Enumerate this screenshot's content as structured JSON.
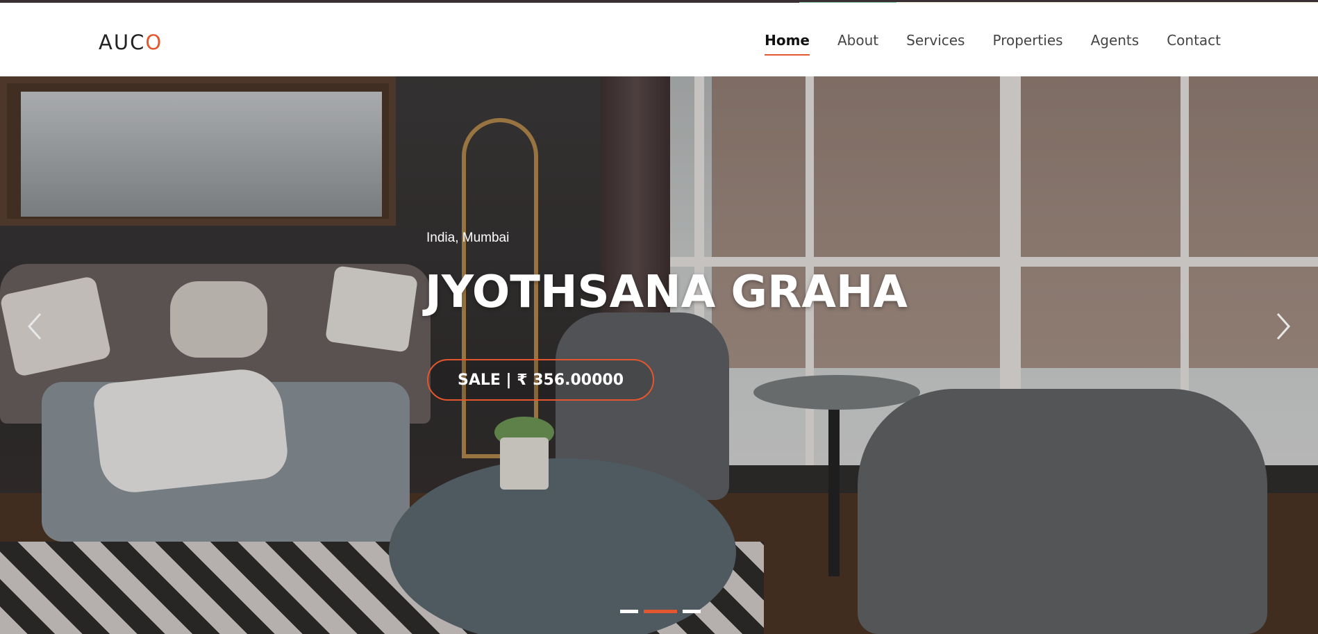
{
  "brand": {
    "logo_text_a": "AUC",
    "logo_text_b": "O"
  },
  "nav": {
    "items": [
      {
        "label": "Home",
        "active": true
      },
      {
        "label": "About",
        "active": false
      },
      {
        "label": "Services",
        "active": false
      },
      {
        "label": "Properties",
        "active": false
      },
      {
        "label": "Agents",
        "active": false
      },
      {
        "label": "Contact",
        "active": false
      }
    ]
  },
  "hero": {
    "location": "India, Mumbai",
    "title": "JYOTHSANA GRAHA",
    "price_label": "SALE | ₹ 356.00000",
    "prev_icon": "chevron-left-icon",
    "next_icon": "chevron-right-icon",
    "slides_count": 3,
    "active_slide": 2
  },
  "colors": {
    "accent": "#e4572e",
    "nav_text": "#444444",
    "header_bg": "#ffffff"
  }
}
